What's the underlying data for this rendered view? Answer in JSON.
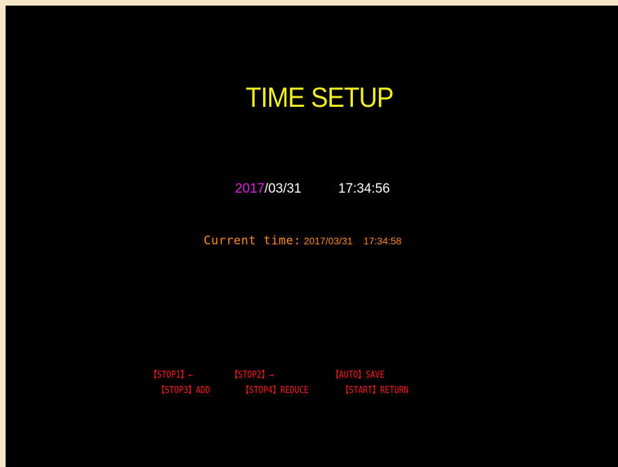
{
  "screen": {
    "title": "TIME SETUP",
    "editor": {
      "year": "2017",
      "sep1": "/",
      "month": "03",
      "sep2": "/",
      "day": "31",
      "hour": "17",
      "colon1": ":",
      "minute": "34",
      "colon2": ":",
      "second": "56"
    },
    "current": {
      "label": "Current time:",
      "date": "2017/03/31",
      "time": "17:34:58"
    },
    "hints": {
      "row1": [
        "【STOP1】←",
        "【STOP2】→",
        "【AUTO】SAVE"
      ],
      "row2": [
        "【STOP3】ADD",
        "【STOP4】REDUCE",
        "【START】RETURN"
      ]
    }
  },
  "colors": {
    "title": "#f2f01e",
    "selected_field": "#e020e0",
    "value": "#ffffff",
    "current_time": "#ff8a1a",
    "hints": "#ff1a1a",
    "background": "#000000",
    "frame": "#f6e6c8"
  }
}
